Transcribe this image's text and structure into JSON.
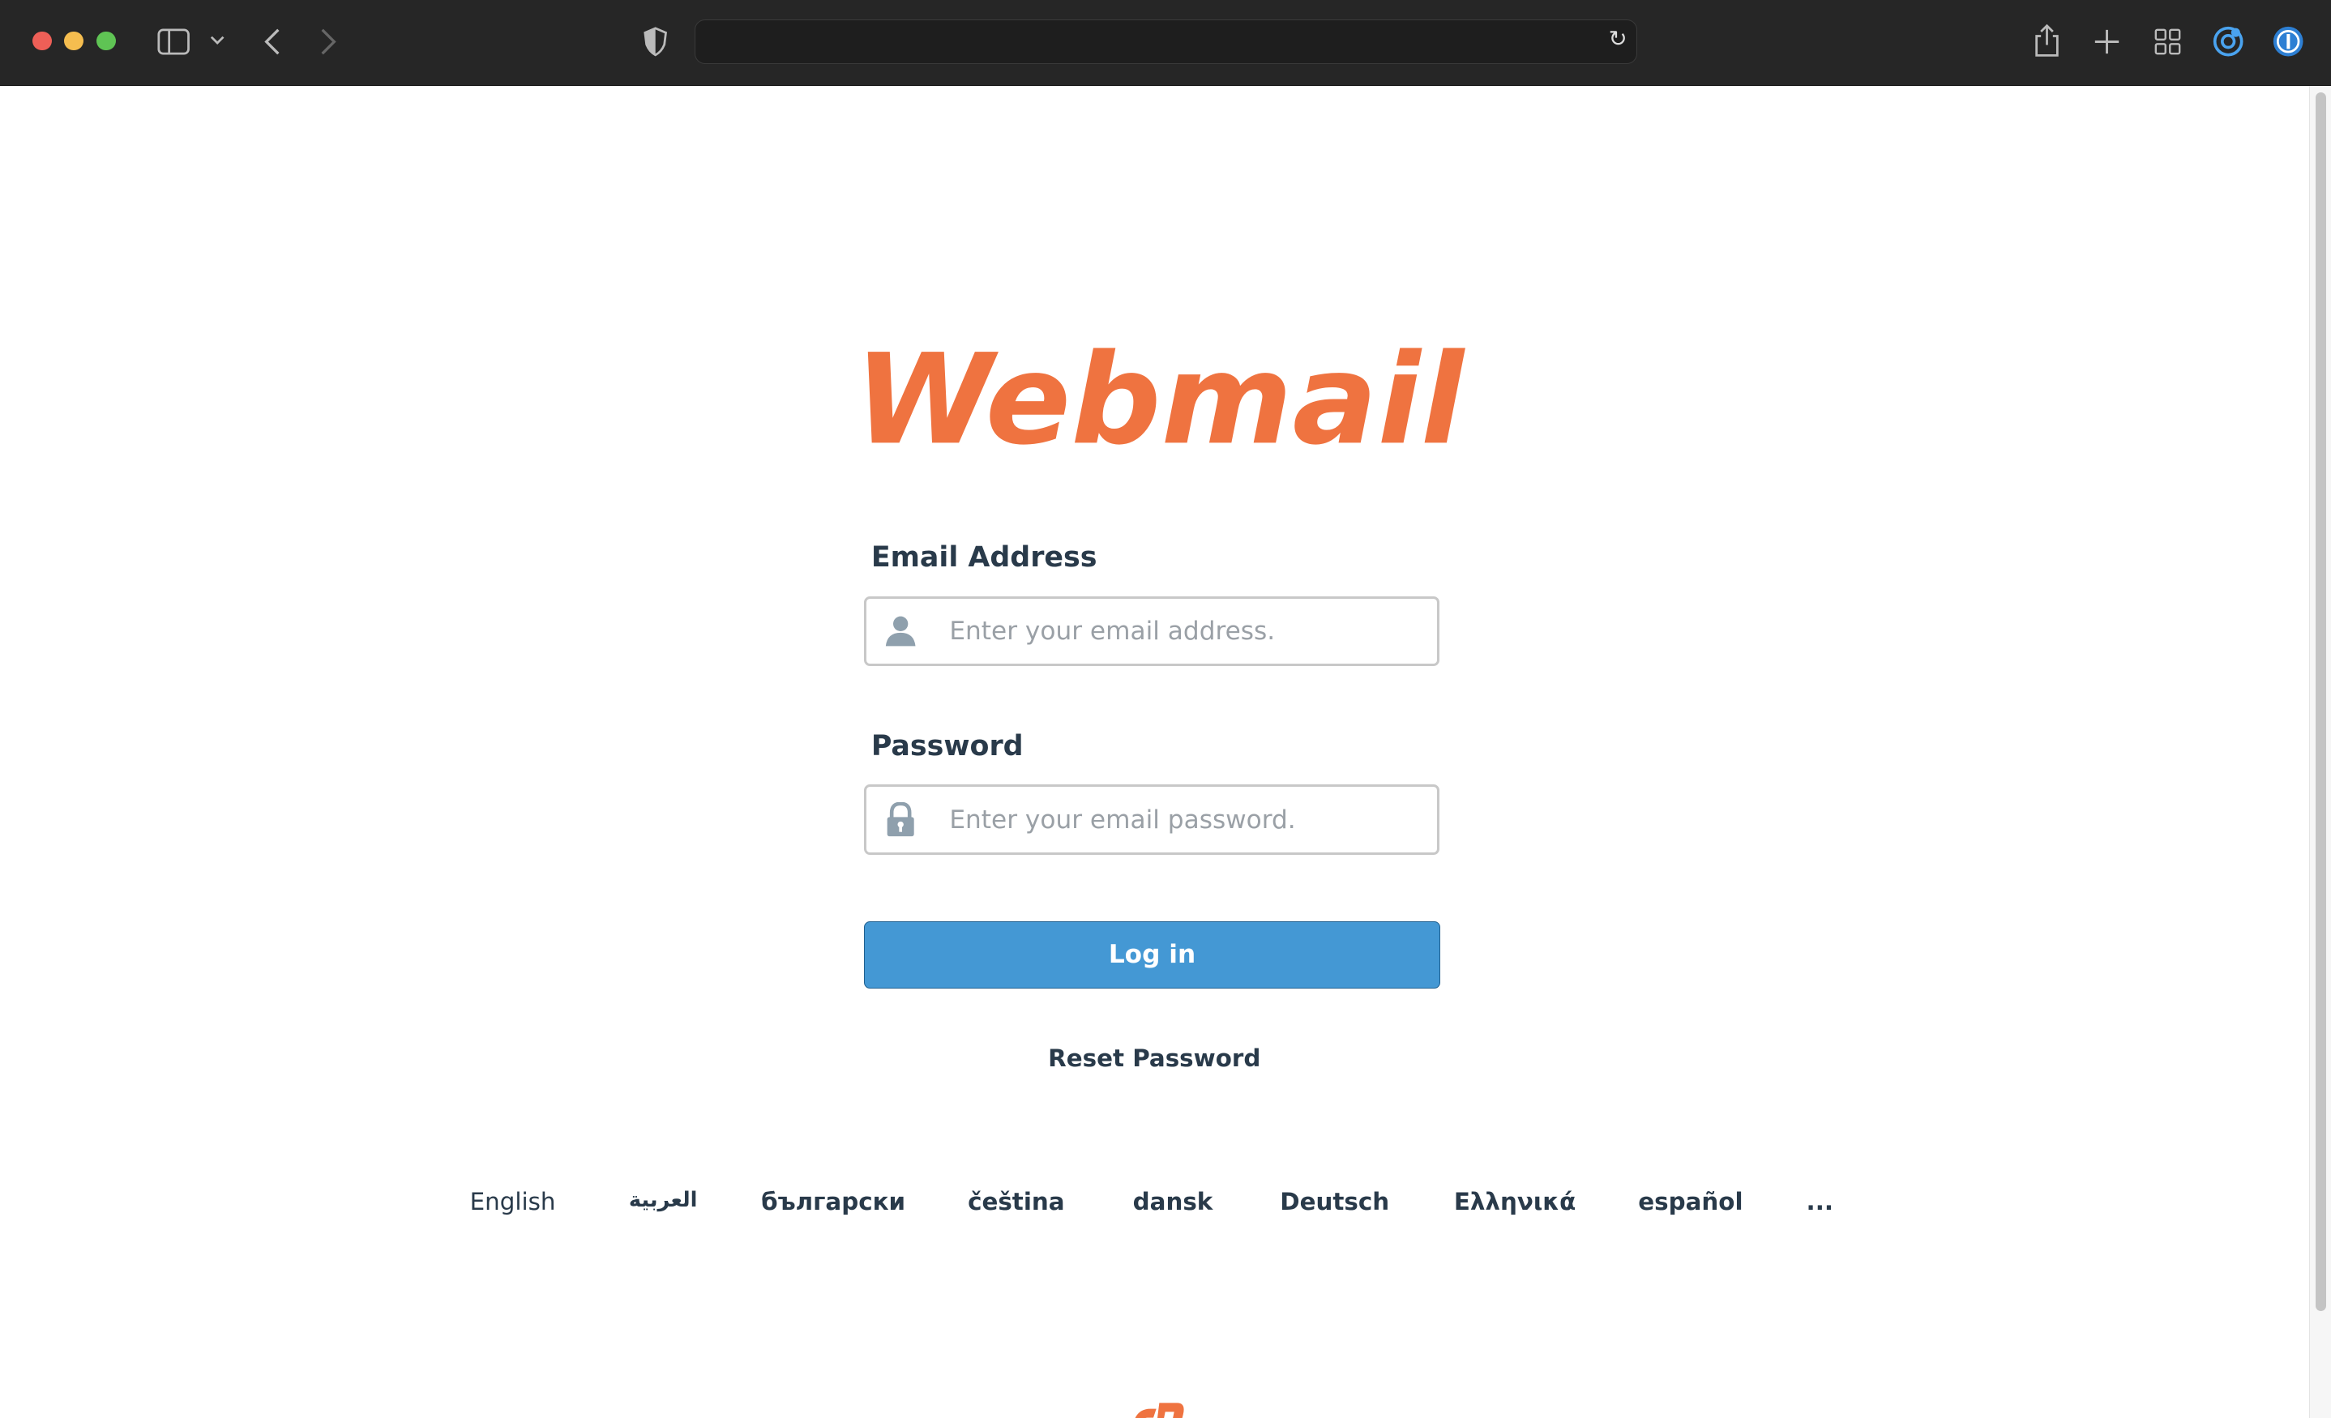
{
  "browser": {
    "url": "",
    "icons": [
      "close-dot",
      "minimize-dot",
      "zoom-dot",
      "sidebar-icon",
      "chevron-down-icon",
      "back-icon",
      "forward-icon",
      "shield-icon",
      "reload-icon",
      "share-icon",
      "new-tab-icon",
      "tab-overview-icon",
      "extension-icon",
      "password-manager-icon"
    ],
    "colors": {
      "close": "#ee5f57",
      "minimize": "#f5bd4f",
      "zoom": "#5fc454"
    }
  },
  "page": {
    "logo_text": "Webmail",
    "brand_color": "#ef7340",
    "email": {
      "label": "Email Address",
      "placeholder": "Enter your email address.",
      "value": ""
    },
    "password": {
      "label": "Password",
      "placeholder": "Enter your email password.",
      "value": ""
    },
    "login_label": "Log in",
    "login_color": "#4498d4",
    "reset_label": "Reset Password",
    "languages": [
      "English",
      "العربية",
      "български",
      "čeština",
      "dansk",
      "Deutsch",
      "Ελληνικά",
      "español",
      "..."
    ]
  }
}
